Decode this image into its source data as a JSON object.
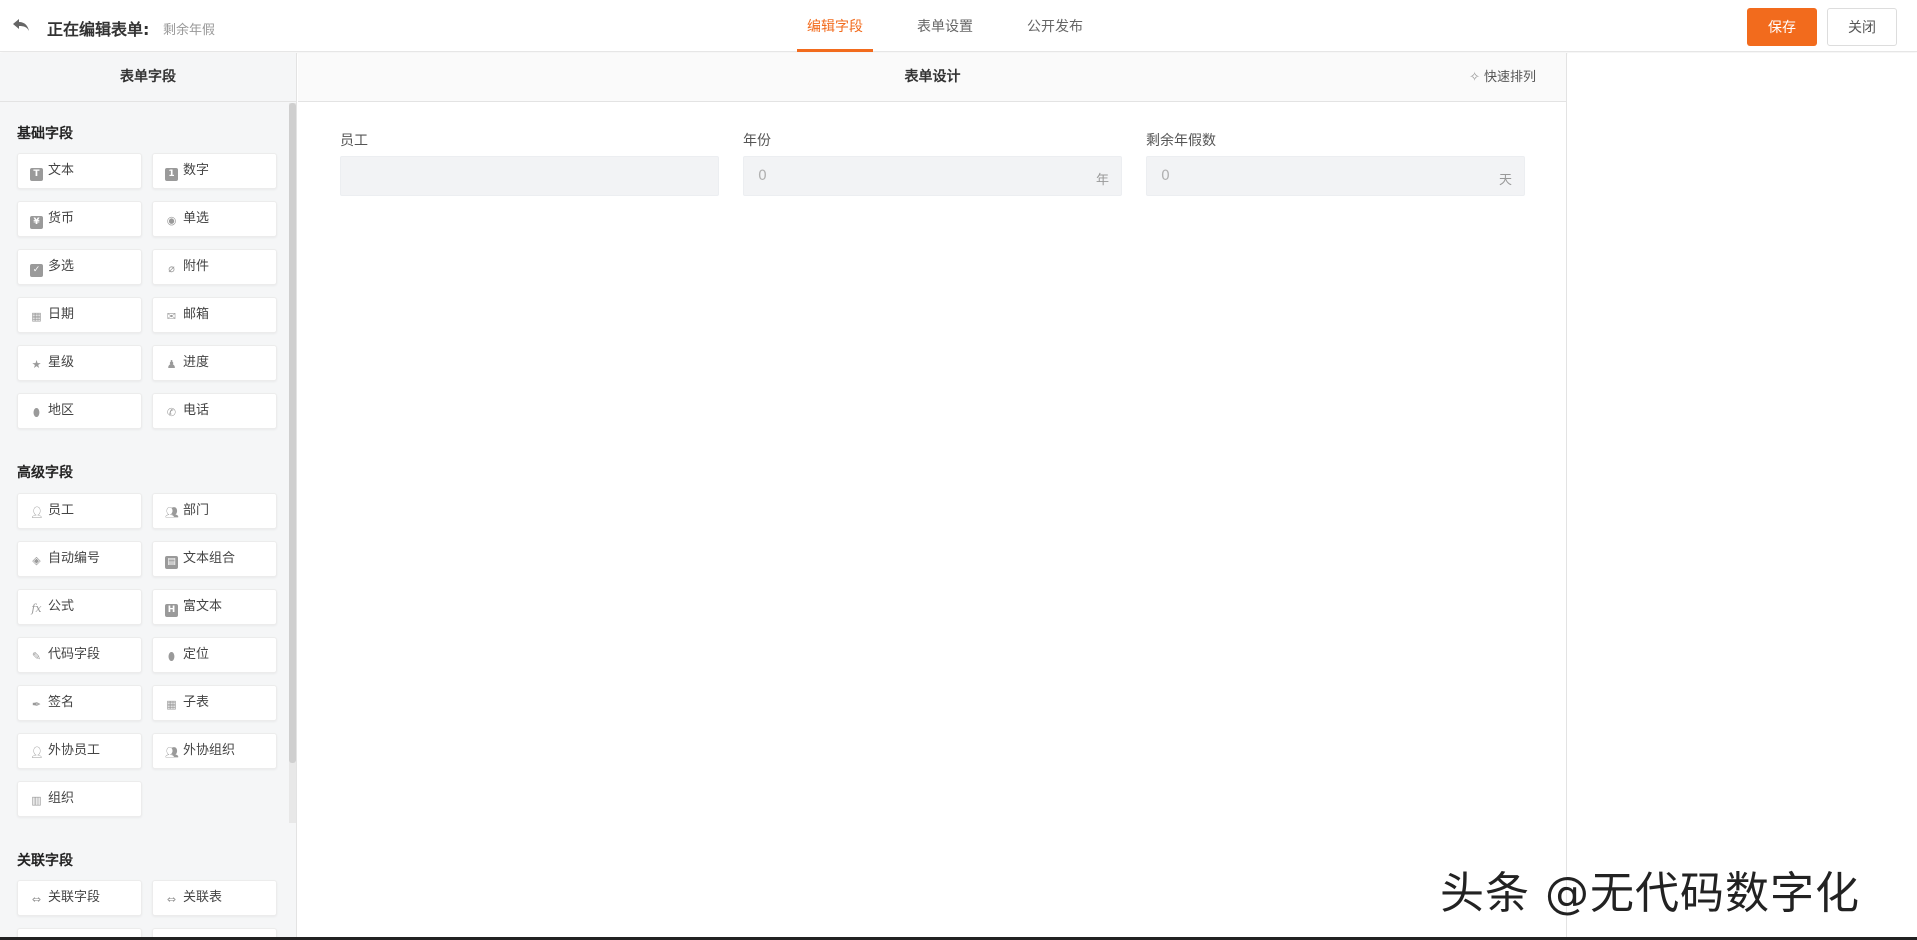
{
  "header": {
    "editing_label": "正在编辑表单:",
    "form_name": "剩余年假",
    "tabs": [
      {
        "label": "编辑字段",
        "active": true
      },
      {
        "label": "表单设置",
        "active": false
      },
      {
        "label": "公开发布",
        "active": false
      }
    ],
    "save_label": "保存",
    "close_label": "关闭",
    "accent_color": "#f26b1d"
  },
  "left_panel": {
    "title": "表单字段",
    "sections": [
      {
        "title": "基础字段",
        "items": [
          {
            "label": "文本",
            "icon": "text-icon"
          },
          {
            "label": "数字",
            "icon": "number-icon"
          },
          {
            "label": "货币",
            "icon": "currency-icon"
          },
          {
            "label": "单选",
            "icon": "radio-icon"
          },
          {
            "label": "多选",
            "icon": "checkbox-icon"
          },
          {
            "label": "附件",
            "icon": "attachment-icon"
          },
          {
            "label": "日期",
            "icon": "calendar-icon"
          },
          {
            "label": "邮箱",
            "icon": "mail-icon"
          },
          {
            "label": "星级",
            "icon": "star-icon"
          },
          {
            "label": "进度",
            "icon": "progress-icon"
          },
          {
            "label": "地区",
            "icon": "location-pin-icon"
          },
          {
            "label": "电话",
            "icon": "phone-icon"
          }
        ]
      },
      {
        "title": "高级字段",
        "items": [
          {
            "label": "员工",
            "icon": "user-icon"
          },
          {
            "label": "部门",
            "icon": "users-icon"
          },
          {
            "label": "自动编号",
            "icon": "tag-icon"
          },
          {
            "label": "文本组合",
            "icon": "copy-icon"
          },
          {
            "label": "公式",
            "icon": "formula-icon"
          },
          {
            "label": "富文本",
            "icon": "rich-text-icon"
          },
          {
            "label": "代码字段",
            "icon": "pencil-icon"
          },
          {
            "label": "定位",
            "icon": "map-marker-icon"
          },
          {
            "label": "签名",
            "icon": "feather-icon"
          },
          {
            "label": "子表",
            "icon": "table-icon"
          },
          {
            "label": "外协员工",
            "icon": "user-icon"
          },
          {
            "label": "外协组织",
            "icon": "users-icon"
          },
          {
            "label": "组织",
            "icon": "building-icon"
          }
        ]
      },
      {
        "title": "关联字段",
        "items": [
          {
            "label": "关联字段",
            "icon": "link-icon"
          },
          {
            "label": "关联表",
            "icon": "link-icon"
          }
        ]
      }
    ]
  },
  "design": {
    "title": "表单设计",
    "quick_sort_label": "快速排列",
    "fields": [
      {
        "label": "员工",
        "placeholder": "",
        "unit": ""
      },
      {
        "label": "年份",
        "placeholder": "0",
        "unit": "年"
      },
      {
        "label": "剩余年假数",
        "placeholder": "0",
        "unit": "天"
      }
    ]
  },
  "watermark": "头条 @无代码数字化"
}
